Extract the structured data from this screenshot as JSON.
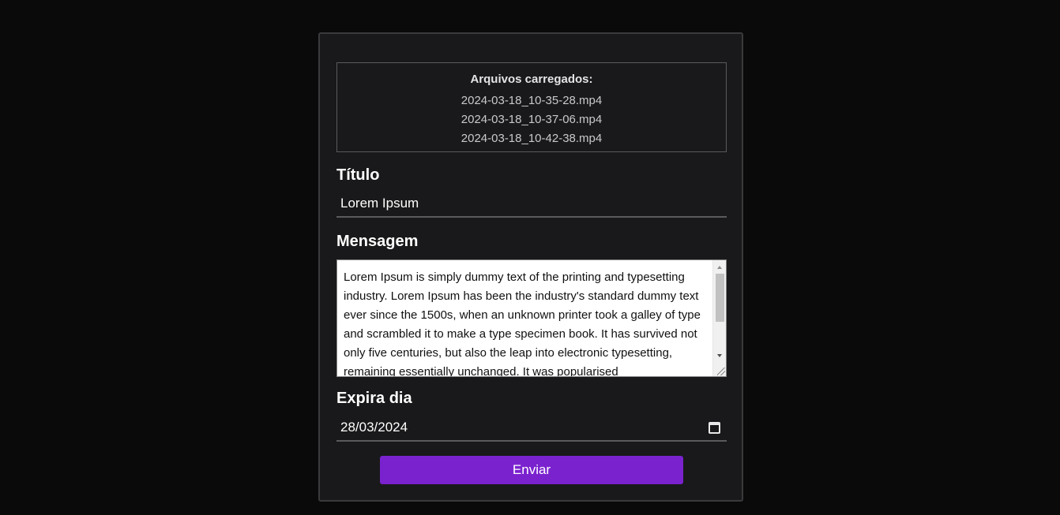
{
  "uploaded_files": {
    "heading": "Arquivos carregados:",
    "files": [
      "2024-03-18_10-35-28.mp4",
      "2024-03-18_10-37-06.mp4",
      "2024-03-18_10-42-38.mp4"
    ]
  },
  "form": {
    "title_label": "Título",
    "title_value": "Lorem Ipsum",
    "message_label": "Mensagem",
    "message_value": "Lorem Ipsum is simply dummy text of the printing and typesetting industry. Lorem Ipsum has been the industry's standard dummy text ever since the 1500s, when an unknown printer took a galley of type and scrambled it to make a type specimen book. It has survived not only five centuries, but also the leap into electronic typesetting, remaining essentially unchanged. It was popularised",
    "expires_label": "Expira dia",
    "expires_value": "28/03/2024",
    "submit_label": "Enviar"
  },
  "colors": {
    "background": "#0a0a0b",
    "card": "#19191b",
    "accent": "#7b22cf"
  },
  "icons": {
    "date": "calendar-icon"
  }
}
